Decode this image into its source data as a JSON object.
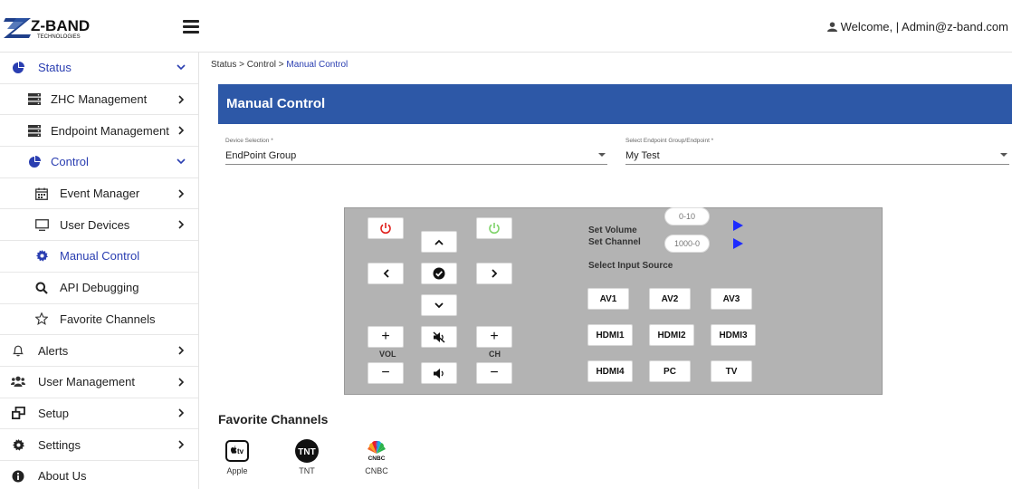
{
  "brand": {
    "name": "Z-BAND",
    "sub": "TECHNOLOGIES"
  },
  "header": {
    "welcome": "Welcome, | Admin@z-band.com"
  },
  "sidebar": {
    "status": "Status",
    "zhc": "ZHC Management",
    "endpoint": "Endpoint Management",
    "control": "Control",
    "event_manager": "Event Manager",
    "user_devices": "User Devices",
    "manual_control": "Manual Control",
    "api_debugging": "API Debugging",
    "favorite_channels": "Favorite Channels",
    "alerts": "Alerts",
    "user_management": "User Management",
    "setup": "Setup",
    "settings": "Settings",
    "about": "About Us"
  },
  "breadcrumb": {
    "p1": "Status",
    "p2": "Control",
    "p3": "Manual Control",
    "sep": ">"
  },
  "page": {
    "title": "Manual Control"
  },
  "device_select": {
    "caption": "Device Selection *",
    "value": "EndPoint Group"
  },
  "endpoint_select": {
    "caption": "Select Endpoint Group/Endpoint *",
    "value": "My Test"
  },
  "remote": {
    "vol_label": "VOL",
    "ch_label": "CH",
    "set_volume": "Set Volume",
    "volume_placeholder": "0-10",
    "set_channel": "Set Channel",
    "channel_placeholder": "1000-0",
    "select_input": "Select Input Source",
    "inputs": [
      "AV1",
      "AV2",
      "AV3",
      "HDMI1",
      "HDMI2",
      "HDMI3",
      "HDMI4",
      "PC",
      "TV"
    ],
    "plus": "+",
    "minus": "−"
  },
  "favorites": {
    "title": "Favorite Channels",
    "apple": "Apple",
    "apple_logo_text": "tv",
    "tnt": "TNT",
    "tnt_logo_text": "TNT",
    "cnbc": "CNBC",
    "cnbc_logo_text": "CNBC"
  },
  "colors": {
    "primary": "#2d58a7",
    "nav_active": "#2a3eb1",
    "power_off": "#e0201c",
    "power_on": "#7fd36a",
    "play": "#1d2bff",
    "panel": "#b3b3b3"
  }
}
